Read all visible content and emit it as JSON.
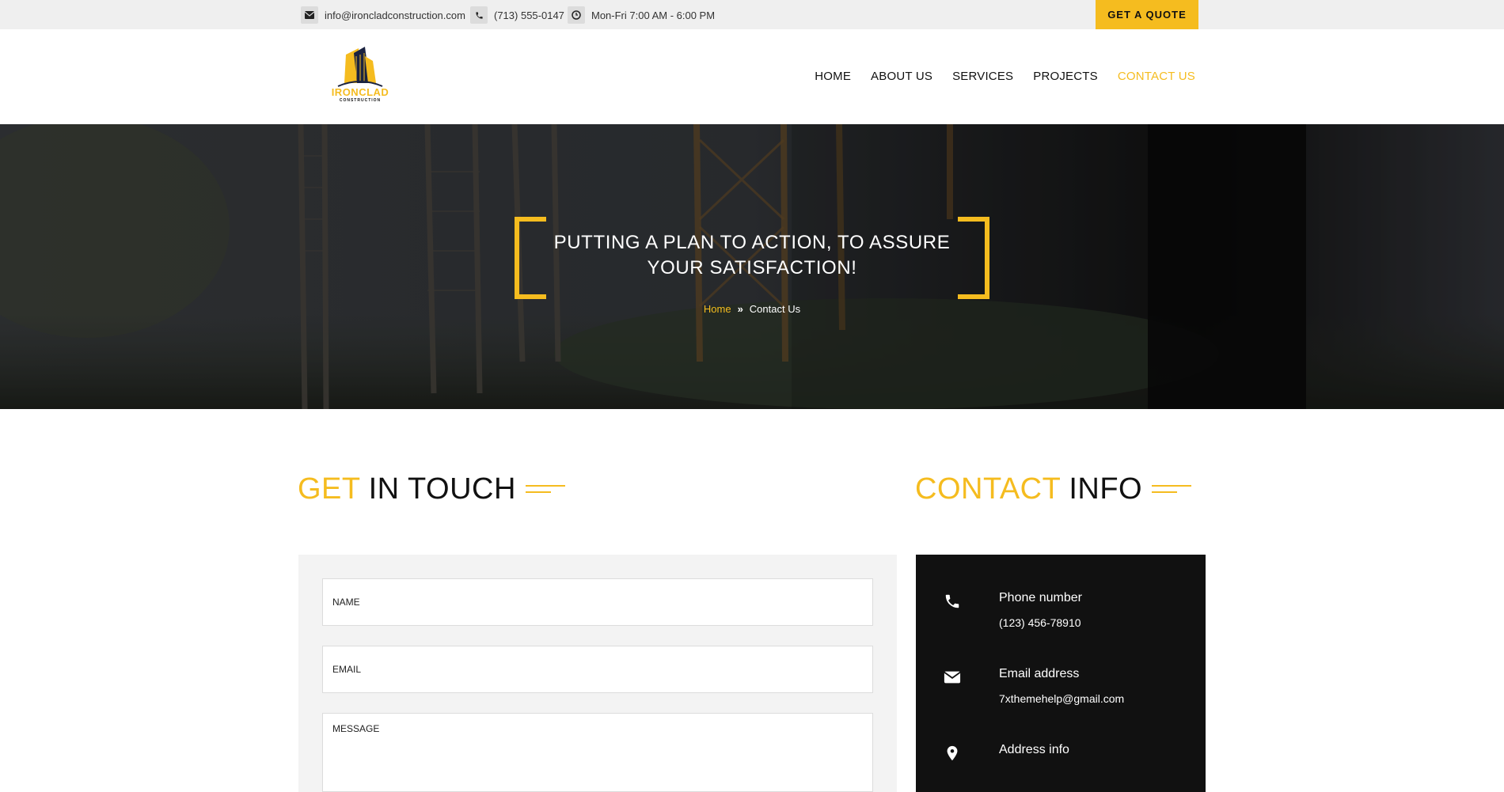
{
  "topbar": {
    "email": "info@ironcladconstruction.com",
    "phone": "(713) 555-0147",
    "hours": "Mon-Fri 7:00 AM - 6:00 PM",
    "quote_label": "GET A QUOTE"
  },
  "logo": {
    "name": "IRONCLAD",
    "tagline": "CONSTRUCTION"
  },
  "nav": {
    "items": [
      "HOME",
      "ABOUT US",
      "SERVICES",
      "PROJECTS",
      "CONTACT US"
    ],
    "active": "CONTACT US"
  },
  "hero": {
    "title": "PUTTING A PLAN TO ACTION, TO ASSURE YOUR SATISFACTION!",
    "breadcrumb_home": "Home",
    "breadcrumb_current": "Contact Us"
  },
  "get_in_touch": {
    "highlight": "GET",
    "rest": "IN TOUCH"
  },
  "form": {
    "name_placeholder": "NAME",
    "email_placeholder": "EMAIL",
    "message_placeholder": "MESSAGE"
  },
  "contact_info": {
    "highlight": "CONTACT",
    "rest": "INFO",
    "items": [
      {
        "label": "Phone number",
        "value": "(123) 456-78910",
        "icon": "phone-icon"
      },
      {
        "label": "Email address",
        "value": "7xthemehelp@gmail.com",
        "icon": "envelope-icon"
      },
      {
        "label": "Address info",
        "value": "",
        "icon": "map-pin-icon"
      }
    ]
  },
  "colors": {
    "accent": "#f5bc1f",
    "dark": "#111111",
    "topbar": "#efefef"
  }
}
